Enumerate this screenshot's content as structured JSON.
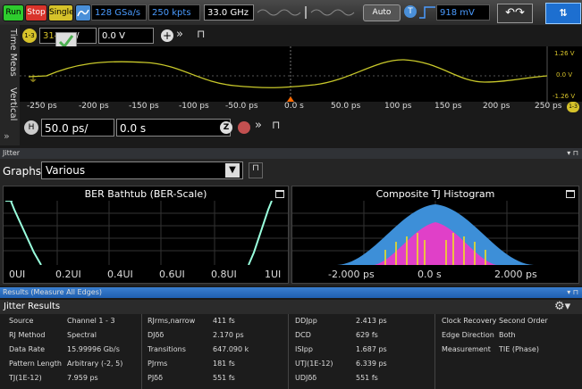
{
  "toolbar": {
    "run": "Run",
    "stop": "Stop",
    "single": "Single",
    "sample_rate": "128 GSa/s",
    "memory": "250 kpts",
    "bandwidth": "33.0 GHz",
    "auto": "Auto",
    "trigger_level": "918 mV",
    "run_color": "#2ecc2e",
    "stop_color": "#d9342b",
    "single_color": "#d6c22a"
  },
  "channel": {
    "badge": "1-3",
    "scale_partial": "314",
    "scale_suffix": "/",
    "offset": "0.0 V"
  },
  "side_tabs": [
    "Time Meas",
    "Vertical"
  ],
  "waveform": {
    "right_labels": [
      "1.26 V",
      "0.0 V",
      "-1.26 V"
    ],
    "time_ticks": [
      "-250 ps",
      "-200 ps",
      "-150 ps",
      "-100 ps",
      "-50.0 ps",
      "0.0 s",
      "50.0 ps",
      "100 ps",
      "150 ps",
      "200 ps",
      "250 ps"
    ],
    "trace_color": "#c8c82a"
  },
  "horizontal": {
    "badge": "H",
    "scale": "50.0 ps/",
    "position": "0.0 s"
  },
  "jitter_panel": {
    "title": "Jitter",
    "graphs_label": "Graphs",
    "graphs_value": "Various"
  },
  "bathtub": {
    "title": "BER Bathtub (BER-Scale)",
    "x_ticks": [
      "0UI",
      "0.2UI",
      "0.4UI",
      "0.6UI",
      "0.8UI",
      "1UI"
    ]
  },
  "histogram": {
    "title": "Composite TJ Histogram",
    "x_ticks": [
      "-2.000 ps",
      "0.0 s",
      "2.000 ps"
    ]
  },
  "results": {
    "bar_title": "Results  (Measure All Edges)",
    "section_title": "Jitter Results",
    "columns": [
      [
        [
          "Source",
          "Channel 1 - 3"
        ],
        [
          "RJ Method",
          "Spectral"
        ],
        [
          "Data Rate",
          "15.99996 Gb/s"
        ],
        [
          "Pattern Length",
          "Arbitrary (-2, 5)"
        ],
        [
          "TJ(1E-12)",
          "7.959 ps"
        ]
      ],
      [
        [
          "RJrms,narrow",
          "411 fs"
        ],
        [
          "DJδδ",
          "2.170 ps"
        ],
        [
          "Transitions",
          "647.090 k"
        ],
        [
          "PJrms",
          "181 fs"
        ],
        [
          "PJδδ",
          "551 fs"
        ]
      ],
      [
        [
          "DDJpp",
          "2.413 ps"
        ],
        [
          "DCD",
          "629 fs"
        ],
        [
          "ISIpp",
          "1.687 ps"
        ],
        [
          "UTJ(1E-12)",
          "6.339 ps"
        ],
        [
          "UDJδδ",
          "551 fs"
        ]
      ],
      [
        [
          "Clock Recovery",
          "Second Order"
        ],
        [
          "Edge Direction",
          "Both"
        ],
        [
          "Measurement",
          "TIE (Phase)"
        ]
      ]
    ]
  }
}
